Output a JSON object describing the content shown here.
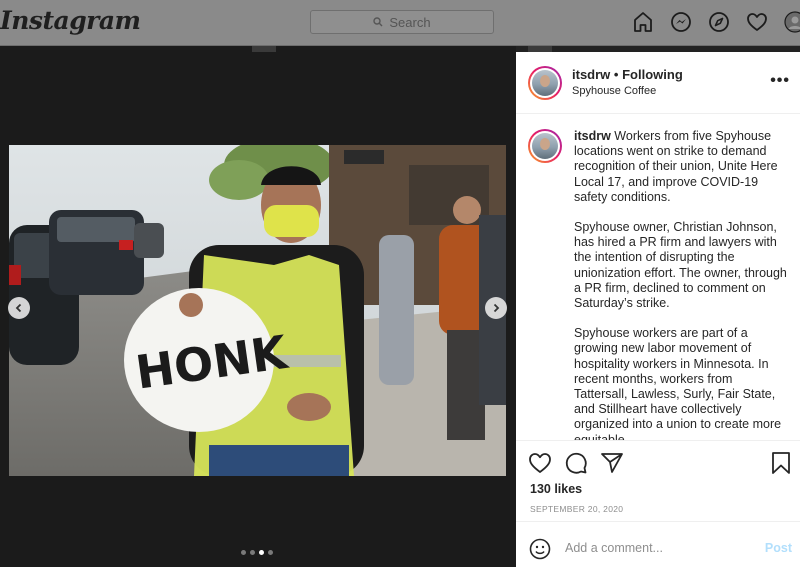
{
  "nav": {
    "logo": "Instagram",
    "search_placeholder": "Search",
    "icons": [
      "home-icon",
      "messenger-icon",
      "explore-icon",
      "heart-icon",
      "profile-avatar"
    ]
  },
  "post": {
    "username": "itsdrw",
    "follow_separator": "•",
    "follow_status": "Following",
    "location": "Spyhouse Coffee",
    "more": "•••",
    "image_sign_text": "HONK",
    "carousel": {
      "total": 4,
      "active": 3
    },
    "caption_paragraphs": [
      "Workers from five Spyhouse locations went on strike to demand recognition of their union, Unite Here Local 17, and improve COVID-19 safety conditions.",
      "Spyhouse owner, Christian Johnson, has hired a PR firm and lawyers with the intention of disrupting the unionization effort. The owner, through a PR firm, declined to comment on Saturday’s strike.",
      "Spyhouse workers are part of a growing new labor movement of hospitality workers in Minnesota. In recent months, workers from Tattersall, Lawless, Surly, Fair State, and Stillheart have collectively organized into a union to create more equitable"
    ],
    "likes": "130 likes",
    "date": "SEPTEMBER 20, 2020",
    "comment_placeholder": "Add a comment...",
    "post_label": "Post"
  },
  "colors": {
    "accent": "#0095f6",
    "post_disabled": "#b2dffc",
    "muted_text": "#8e8e8e"
  }
}
